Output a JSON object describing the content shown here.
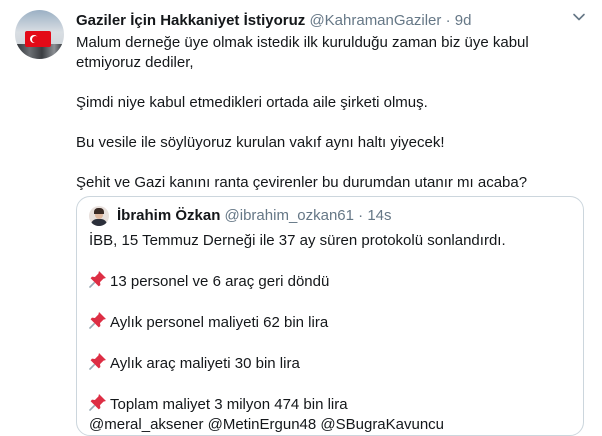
{
  "tweet": {
    "author_name": "Gaziler İçin Hakkaniyet İstiyoruz",
    "author_handle": "@KahramanGaziler",
    "separator": "·",
    "time": "9d",
    "menu_icon": "chevron-down-icon",
    "paragraphs": [
      "Malum derneğe üye olmak istedik ilk kurulduğu zaman biz üye kabul etmiyoruz dediler,",
      "Şimdi niye kabul etmedikleri ortada aile şirketi olmuş.",
      "Bu vesile ile söylüyoruz kurulan vakıf aynı haltı yiyecek!",
      "Şehit ve Gazi kanını ranta çevirenler bu durumdan utanır mı acaba?"
    ]
  },
  "quoted": {
    "author_name": "İbrahim Özkan",
    "author_handle": "@ibrahim_ozkan61",
    "separator": "·",
    "time": "14s",
    "intro": "İBB, 15 Temmuz Derneği ile 37 ay süren protokolü sonlandırdı.",
    "bullet_icon": "pushpin-icon",
    "bullets": [
      "13 personel ve 6 araç geri döndü",
      "Aylık personel maliyeti 62 bin lira",
      "Aylık araç maliyeti 30 bin lira",
      "Toplam maliyet 3 milyon 474 bin lira"
    ],
    "mentions": "@meral_aksener @MetinErgun48 @SBugraKavuncu"
  }
}
